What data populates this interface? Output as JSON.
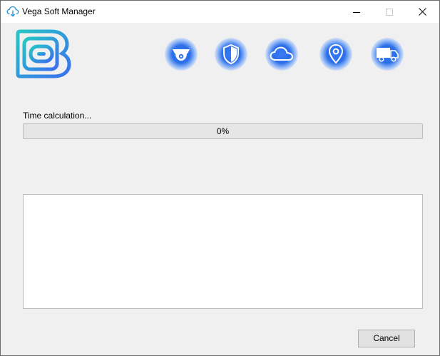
{
  "window": {
    "title": "Vega Soft Manager"
  },
  "icons": {
    "title_icon": "cloud-download-icon",
    "logo": "vega-logo",
    "features": [
      "camera-icon",
      "shield-icon",
      "cloud-icon",
      "location-pin-icon",
      "truck-icon"
    ]
  },
  "status": {
    "label": "Time calculation...",
    "progress_text": "0%",
    "progress_value": 0
  },
  "log": {
    "content": ""
  },
  "buttons": {
    "cancel": "Cancel"
  },
  "colors": {
    "accent_blue": "#2b6de8",
    "logo_gradient_start": "#26c6c6",
    "logo_gradient_end": "#3b6ff0",
    "progress_fill": "#06b025"
  }
}
